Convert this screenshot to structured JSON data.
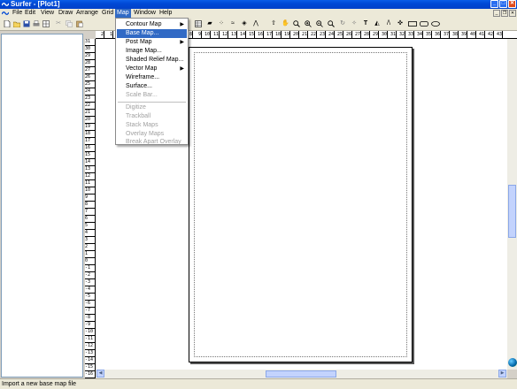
{
  "window": {
    "title": "Surfer - [Plot1]",
    "minimize": "_",
    "maximize": "□",
    "close": "✕"
  },
  "menubar": {
    "items": [
      "File",
      "Edit",
      "View",
      "Draw",
      "Arrange",
      "Grid",
      "Map",
      "Window",
      "Help"
    ],
    "active": "Map"
  },
  "map_menu": {
    "items": [
      {
        "label": "Contour Map",
        "submenu": true,
        "enabled": true
      },
      {
        "label": "Base Map...",
        "submenu": false,
        "enabled": true,
        "highlighted": true
      },
      {
        "label": "Post Map",
        "submenu": true,
        "enabled": true
      },
      {
        "label": "Image Map...",
        "submenu": false,
        "enabled": true
      },
      {
        "label": "Shaded Relief Map...",
        "submenu": false,
        "enabled": true
      },
      {
        "label": "Vector Map",
        "submenu": true,
        "enabled": true
      },
      {
        "label": "Wireframe...",
        "submenu": false,
        "enabled": true
      },
      {
        "label": "Surface...",
        "submenu": false,
        "enabled": true
      },
      {
        "label": "Scale Bar...",
        "submenu": false,
        "enabled": false
      },
      {
        "label": "Digitize",
        "submenu": false,
        "enabled": false
      },
      {
        "label": "Trackball",
        "submenu": false,
        "enabled": false
      },
      {
        "label": "Stack Maps",
        "submenu": false,
        "enabled": false
      },
      {
        "label": "Overlay Maps",
        "submenu": false,
        "enabled": false
      },
      {
        "label": "Break Apart Overlay",
        "submenu": false,
        "enabled": false
      }
    ]
  },
  "toolbar": {
    "left_icons": [
      "new-icon",
      "open-icon",
      "save-icon",
      "print-icon",
      "grid-view-icon",
      "cut-icon",
      "copy-icon",
      "paste-icon"
    ],
    "right_tools": [
      "select-arrow",
      "hand",
      "zoom-in",
      "zoom-in-plus",
      "zoom-out",
      "zoom-rect",
      "rotate",
      "reshape",
      "T",
      "polygon-fill",
      "N",
      "cross",
      "rectangle",
      "rounded-rect",
      "ellipse"
    ]
  },
  "rulers": {
    "horizontal": [
      "2",
      "1",
      "0",
      "1",
      "2",
      "3",
      "4",
      "5",
      "6",
      "7",
      "8",
      "9",
      "10",
      "11",
      "12",
      "13",
      "14",
      "15",
      "16",
      "17",
      "18",
      "19",
      "20",
      "21",
      "22",
      "23",
      "24",
      "25",
      "26",
      "27",
      "28",
      "29",
      "30",
      "31",
      "32",
      "33",
      "34",
      "35",
      "36",
      "37",
      "38",
      "39",
      "40",
      "41",
      "42",
      "43"
    ],
    "vertical": [
      "31",
      "30",
      "29",
      "28",
      "27",
      "26",
      "25",
      "24",
      "23",
      "22",
      "21",
      "20",
      "19",
      "18",
      "17",
      "16",
      "15",
      "14",
      "13",
      "12",
      "11",
      "10",
      "9",
      "8",
      "7",
      "6",
      "5",
      "4",
      "3",
      "2",
      "1",
      "0",
      "-1",
      "-2",
      "-3",
      "-4",
      "-5",
      "-6",
      "-7",
      "-8",
      "-9",
      "-10",
      "-11",
      "-12",
      "-13",
      "-14",
      "-15",
      "-16"
    ]
  },
  "status": {
    "text": "Import a new base map file"
  },
  "colors": {
    "titlebar": "#0049d6",
    "highlight": "#316ac5",
    "chrome": "#ece9d8"
  }
}
